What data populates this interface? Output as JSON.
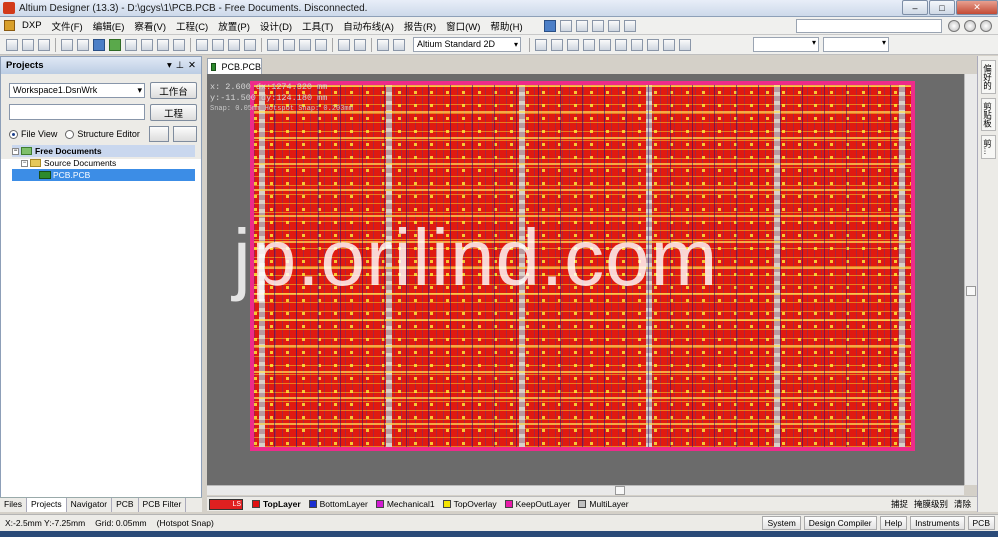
{
  "window": {
    "title": "Altium Designer (13.3) - D:\\gcys\\1\\PCB.PCB - Free Documents. Disconnected."
  },
  "menubar": {
    "items": [
      "DXP",
      "文件(F)",
      "编辑(E)",
      "察看(V)",
      "工程(C)",
      "放置(P)",
      "设计(D)",
      "工具(T)",
      "自动布线(A)",
      "报告(R)",
      "窗口(W)",
      "帮助(H)"
    ]
  },
  "toolbar": {
    "view_mode": "Altium Standard 2D"
  },
  "projects": {
    "title": "Projects",
    "workspace": "Workspace1.DsnWrk",
    "workspace_button": "工作台",
    "project_button": "工程",
    "file_view": "File View",
    "structure_editor": "Structure Editor",
    "tree": [
      {
        "label": "Free Documents",
        "level": 0
      },
      {
        "label": "Source Documents",
        "level": 1
      },
      {
        "label": "PCB.PCB",
        "level": 2
      }
    ],
    "bottom_tabs": [
      "Files",
      "Projects",
      "Navigator",
      "PCB",
      "PCB Filter"
    ]
  },
  "document": {
    "tab": "PCB.PCB",
    "coord_x": "x:  2.600",
    "coord_dx": "dx:1274.320 mm",
    "coord_y": "y:-11.500",
    "coord_dy": "dy:124.180 mm",
    "snap": "Snap: 0.05mm Hotspot Snap: 0.203mm"
  },
  "watermark": "jp.orilind.com",
  "right_dock": [
    "偏好的",
    "剪贴板",
    "剪..."
  ],
  "layers": {
    "ls_label": "LS",
    "tabs": [
      {
        "name": "TopLayer",
        "color": "#e01010",
        "active": true
      },
      {
        "name": "BottomLayer",
        "color": "#1a2fd0",
        "active": false
      },
      {
        "name": "Mechanical1",
        "color": "#d21ad2",
        "active": false
      },
      {
        "name": "TopOverlay",
        "color": "#f5e400",
        "active": false
      },
      {
        "name": "KeepOutLayer",
        "color": "#e81aa8",
        "active": false
      },
      {
        "name": "MultiLayer",
        "color": "#c0c0c0",
        "active": false
      }
    ],
    "right_items": [
      "捕捉",
      "掩膜级别",
      "清除"
    ]
  },
  "status": {
    "coords": "X:-2.5mm Y:-7.25mm",
    "grid": "Grid: 0.05mm",
    "hotspot": "(Hotspot Snap)",
    "panels": [
      "System",
      "Design Compiler",
      "Help",
      "Instruments",
      "PCB"
    ]
  }
}
